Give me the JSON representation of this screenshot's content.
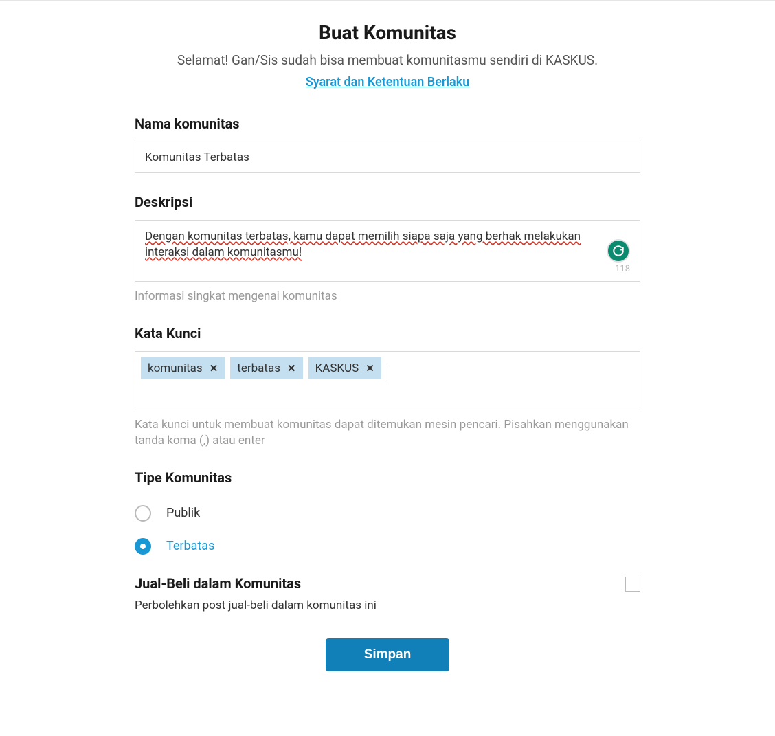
{
  "header": {
    "title": "Buat Komunitas",
    "subtitle": "Selamat! Gan/Sis sudah bisa membuat komunitasmu sendiri di KASKUS.",
    "terms_link": "Syarat dan Ketentuan Berlaku"
  },
  "form": {
    "name": {
      "label": "Nama komunitas",
      "value": "Komunitas Terbatas"
    },
    "description": {
      "label": "Deskripsi",
      "value": "Dengan komunitas terbatas, kamu dapat memilih siapa saja yang berhak melakukan interaksi dalam komunitasmu!",
      "char_count": "118",
      "help": "Informasi singkat mengenai komunitas"
    },
    "keywords": {
      "label": "Kata Kunci",
      "tags": [
        "komunitas",
        "terbatas",
        "KASKUS"
      ],
      "help": "Kata kunci untuk membuat komunitas dapat ditemukan mesin pencari. Pisahkan menggunakan tanda koma (,) atau enter"
    },
    "type": {
      "label": "Tipe Komunitas",
      "options": [
        {
          "label": "Publik",
          "selected": false
        },
        {
          "label": "Terbatas",
          "selected": true
        }
      ]
    },
    "jualbeli": {
      "label": "Jual-Beli dalam Komunitas",
      "description": "Perbolehkan post jual-beli dalam komunitas ini",
      "checked": false
    },
    "submit_label": "Simpan"
  }
}
